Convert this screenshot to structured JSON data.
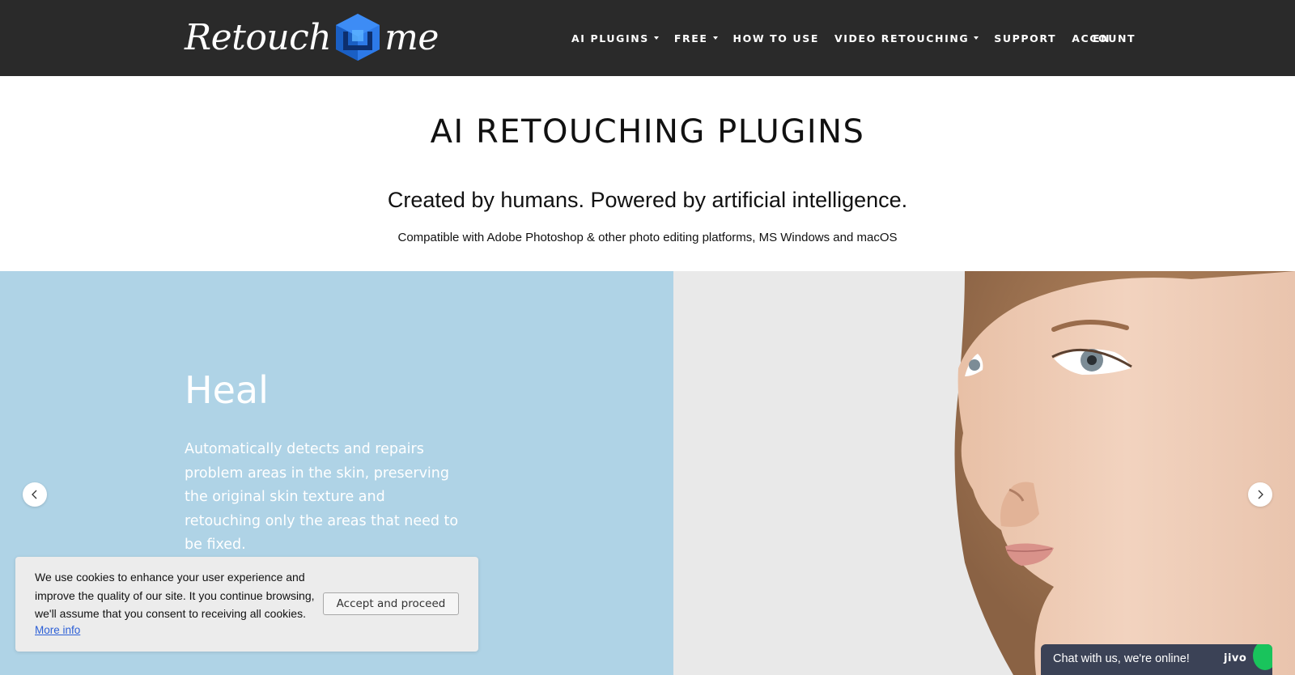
{
  "header": {
    "logo": {
      "text_left": "Retouch",
      "text_right": "me",
      "cube_icon": "cube-logo-icon",
      "cube_color": "#1a73e8"
    },
    "nav": [
      {
        "label": "AI PLUGINS",
        "dropdown": true
      },
      {
        "label": "FREE",
        "dropdown": true
      },
      {
        "label": "HOW TO USE",
        "dropdown": false
      },
      {
        "label": "VIDEO RETOUCHING",
        "dropdown": true
      },
      {
        "label": "SUPPORT",
        "dropdown": false
      },
      {
        "label": "ACCOUNT",
        "dropdown": false
      }
    ],
    "language": "EN",
    "background_color": "#2a2a2a"
  },
  "hero": {
    "title": "AI RETOUCHING PLUGINS",
    "tagline": "Created by humans. Powered by artificial intelligence.",
    "compatibility": "Compatible with Adobe Photoshop & other photo editing platforms, MS Windows and macOS"
  },
  "slider": {
    "slide": {
      "heading": "Heal",
      "description": "Automatically detects and repairs problem areas in the skin, preserving the original skin texture and retouching only the areas that need to be fixed.",
      "panel_color": "#afd3e6",
      "image": "portrait-woman-face"
    },
    "prev_icon": "chevron-left-icon",
    "next_icon": "chevron-right-icon"
  },
  "cookie_banner": {
    "text": "We use cookies to enhance your user experience and improve the quality of our site. It you continue browsing, we'll assume that you consent to receiving all cookies.",
    "more_info": "More info",
    "accept_label": "Accept and proceed"
  },
  "chat_widget": {
    "text": "Chat with us, we're online!",
    "brand": "jivo",
    "background_color": "#3b4256",
    "status_color": "#19c45c"
  }
}
